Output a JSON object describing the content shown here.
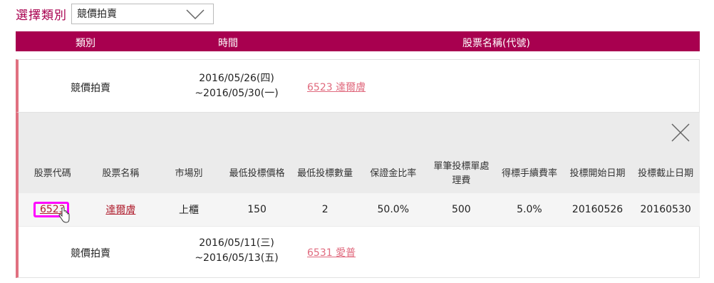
{
  "filter": {
    "label": "選擇類別",
    "selected": "競價拍賣"
  },
  "header": {
    "col_category": "類別",
    "col_time": "時間",
    "col_stock": "股票名稱(代號)"
  },
  "rows": [
    {
      "category": "競價拍賣",
      "date_line1": "2016/05/26(四)",
      "date_line2": "~2016/05/30(一)",
      "stock": "6523 達爾膚"
    },
    {
      "category": "競價拍賣",
      "date_line1": "2016/05/11(三)",
      "date_line2": "~2016/05/13(五)",
      "stock": "6531 愛普"
    }
  ],
  "detail": {
    "headers": [
      "股票代碼",
      "股票名稱",
      "市場別",
      "最低投標價格",
      "最低投標數量",
      "保證金比率",
      "單筆投標單處理費",
      "得標手續費率",
      "投標開始日期",
      "投標截止日期"
    ],
    "values": [
      "6523",
      "達爾膚",
      "上櫃",
      "150",
      "2",
      "50.0%",
      "500",
      "5.0%",
      "20160526",
      "20160530"
    ]
  },
  "colors": {
    "accent": "#a8004f",
    "row_border": "#e07080",
    "link": "#e06a7e",
    "highlight": "#ff00ff"
  },
  "icons": {
    "dropdown": "chevron-down-icon",
    "close": "close-icon",
    "cursor": "hand-cursor-icon"
  }
}
